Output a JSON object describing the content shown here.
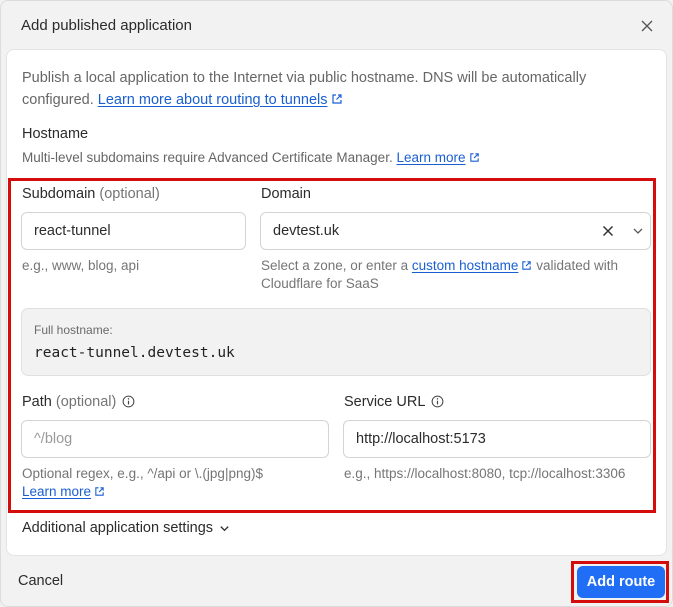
{
  "dialog": {
    "title": "Add published application",
    "close_icon": "close-icon"
  },
  "intro": {
    "text": "Publish a local application to the Internet via public hostname. DNS will be automatically configured.",
    "link": "Learn more about routing to tunnels"
  },
  "hostname": {
    "title": "Hostname",
    "description": "Multi-level subdomains require Advanced Certificate Manager.",
    "learn_more": "Learn more"
  },
  "subdomain": {
    "label": "Subdomain",
    "optional": "(optional)",
    "value": "react-tunnel",
    "help": "e.g., www, blog, api"
  },
  "domain": {
    "label": "Domain",
    "value": "devtest.uk",
    "help_before": "Select a zone, or enter a",
    "help_link": "custom hostname",
    "help_after": "validated with Cloudflare for SaaS"
  },
  "full_hostname": {
    "label": "Full hostname:",
    "value": "react-tunnel.devtest.uk"
  },
  "path": {
    "label": "Path",
    "optional": "(optional)",
    "placeholder": "^/blog",
    "help": "Optional regex, e.g., ^/api or \\.(jpg|png)$",
    "learn_more": "Learn more"
  },
  "service_url": {
    "label": "Service URL",
    "value": "http://localhost:5173",
    "help": "e.g., https://localhost:8080, tcp://localhost:3306"
  },
  "additional": {
    "label": "Additional application settings"
  },
  "footer": {
    "cancel": "Cancel",
    "submit": "Add route"
  },
  "colors": {
    "primary": "#1f6ef5",
    "link": "#1a5fd1",
    "highlight": "#d40c0c"
  }
}
